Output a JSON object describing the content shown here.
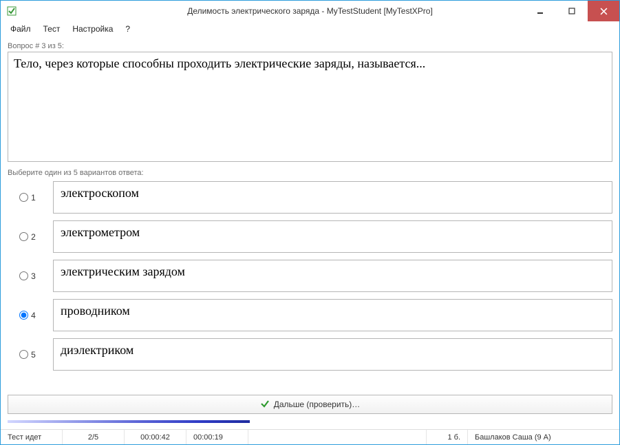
{
  "window": {
    "title": "Делимость электрического заряда - MyTestStudent [MyTestXPro]"
  },
  "menu": {
    "file": "Файл",
    "test": "Тест",
    "settings": "Настройка",
    "help": "?"
  },
  "question": {
    "counter_label": "Вопрос # 3 из 5:",
    "text": "Тело, через которые способны проходить электрические заряды, называется..."
  },
  "answers_label": "Выберите один из 5 вариантов ответа:",
  "answers": [
    {
      "num": "1",
      "text": "электроскопом",
      "selected": false
    },
    {
      "num": "2",
      "text": "электрометром",
      "selected": false
    },
    {
      "num": "3",
      "text": "электрическим зарядом",
      "selected": false
    },
    {
      "num": "4",
      "text": "проводником",
      "selected": true
    },
    {
      "num": "5",
      "text": "диэлектриком",
      "selected": false
    }
  ],
  "next_button": "Дальше (проверить)…",
  "progress_percent": 40,
  "status": {
    "state": "Тест идет",
    "question_progress": "2/5",
    "time1": "00:00:42",
    "time2": "00:00:19",
    "score": "1 б.",
    "user": "Башлаков Саша (9 А)"
  }
}
